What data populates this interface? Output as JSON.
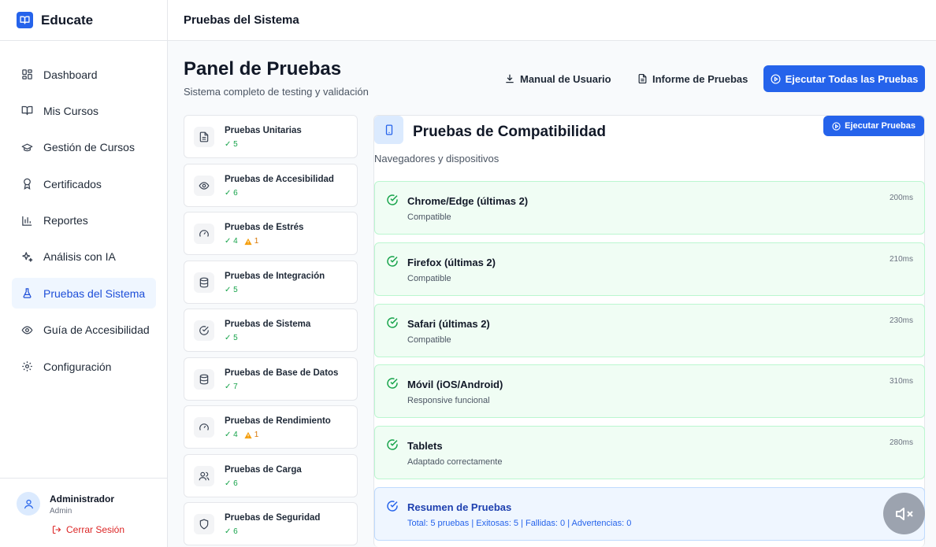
{
  "app": {
    "name": "Educate",
    "brand_color": "#2563eb"
  },
  "sidebar": {
    "items": [
      {
        "label": "Dashboard",
        "icon": "layout-grid-icon"
      },
      {
        "label": "Mis Cursos",
        "icon": "book-open-icon"
      },
      {
        "label": "Gestión de Cursos",
        "icon": "graduation-cap-icon"
      },
      {
        "label": "Certificados",
        "icon": "award-icon"
      },
      {
        "label": "Reportes",
        "icon": "bar-chart-icon"
      },
      {
        "label": "Análisis con IA",
        "icon": "sparkles-icon"
      },
      {
        "label": "Pruebas del Sistema",
        "icon": "flask-icon",
        "active": true
      },
      {
        "label": "Guía de Accesibilidad",
        "icon": "eye-icon"
      },
      {
        "label": "Configuración",
        "icon": "gear-icon"
      }
    ],
    "user": {
      "name": "Administrador",
      "role": "Admin"
    },
    "logout_label": "Cerrar Sesión"
  },
  "header": {
    "title": "Pruebas del Sistema"
  },
  "page": {
    "title": "Panel de Pruebas",
    "subtitle": "Sistema completo de testing y validación",
    "actions": {
      "manual": "Manual de Usuario",
      "informe": "Informe de Pruebas",
      "run_all": "Ejecutar Todas las Pruebas"
    }
  },
  "tests": [
    {
      "name": "Pruebas Unitarias",
      "passed": "✓ 5",
      "warnings": "",
      "icon": "file-text-icon"
    },
    {
      "name": "Pruebas de Accesibilidad",
      "passed": "✓ 6",
      "warnings": "",
      "icon": "eye-icon"
    },
    {
      "name": "Pruebas de Estrés",
      "passed": "✓ 4",
      "warnings": "1",
      "icon": "gauge-icon"
    },
    {
      "name": "Pruebas de Integración",
      "passed": "✓ 5",
      "warnings": "",
      "icon": "database-icon"
    },
    {
      "name": "Pruebas de Sistema",
      "passed": "✓ 5",
      "warnings": "",
      "icon": "check-circle-icon"
    },
    {
      "name": "Pruebas de Base de Datos",
      "passed": "✓ 7",
      "warnings": "",
      "icon": "database-icon"
    },
    {
      "name": "Pruebas de Rendimiento",
      "passed": "✓ 4",
      "warnings": "1",
      "icon": "gauge-icon"
    },
    {
      "name": "Pruebas de Carga",
      "passed": "✓ 6",
      "warnings": "",
      "icon": "users-icon"
    },
    {
      "name": "Pruebas de Seguridad",
      "passed": "✓ 6",
      "warnings": "",
      "icon": "shield-icon"
    }
  ],
  "detail": {
    "title": "Pruebas de Compatibilidad",
    "subtitle": "Navegadores y dispositivos",
    "run_label": "Ejecutar Pruebas",
    "results": [
      {
        "name": "Chrome/Edge (últimas 2)",
        "desc": "Compatible",
        "time": "200ms"
      },
      {
        "name": "Firefox (últimas 2)",
        "desc": "Compatible",
        "time": "210ms"
      },
      {
        "name": "Safari (últimas 2)",
        "desc": "Compatible",
        "time": "230ms"
      },
      {
        "name": "Móvil (iOS/Android)",
        "desc": "Responsive funcional",
        "time": "310ms"
      },
      {
        "name": "Tablets",
        "desc": "Adaptado correctamente",
        "time": "280ms"
      }
    ],
    "summary": {
      "title": "Resumen de Pruebas",
      "text": "Total: 5 pruebas | Exitosas: 5 | Fallidas: 0 | Advertencias: 0"
    }
  },
  "colors": {
    "success_bg": "#f0fdf4",
    "success": "#16a34a",
    "warning": "#d97706",
    "info_bg": "#eff6ff"
  }
}
